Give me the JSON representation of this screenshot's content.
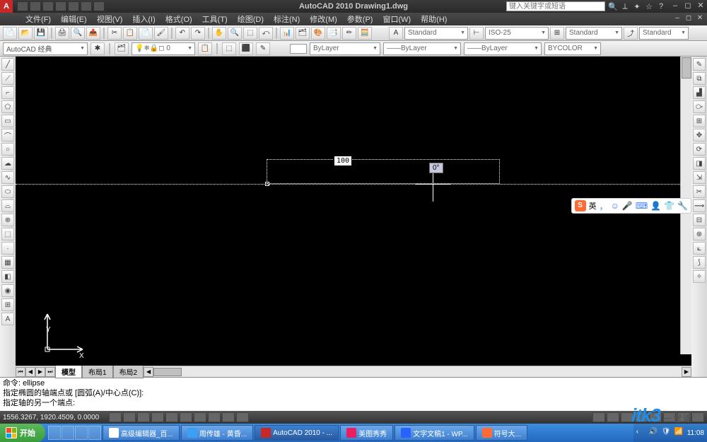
{
  "app": {
    "title": "AutoCAD 2010  Drawing1.dwg",
    "search_placeholder": "键入关键字或短语"
  },
  "menu": [
    "文件(F)",
    "编辑(E)",
    "视图(V)",
    "插入(I)",
    "格式(O)",
    "工具(T)",
    "绘图(D)",
    "标注(N)",
    "修改(M)",
    "参数(P)",
    "窗口(W)",
    "帮助(H)"
  ],
  "workspace": {
    "selector_label": "AutoCAD 经典"
  },
  "style_bar": {
    "text_style": "Standard",
    "dim_style": "ISO-25",
    "table_style": "Standard",
    "multi_style": "Standard"
  },
  "layer_bar": {
    "layer": "ByLayer",
    "linetype": "ByLayer",
    "lineweight": "ByLayer",
    "color_label": "BYCOLOR"
  },
  "canvas": {
    "dyn_value": "100",
    "dyn_angle": "0°",
    "ucs_x": "X",
    "ucs_y": "Y"
  },
  "tabs": {
    "model": "模型",
    "layout1": "布局1",
    "layout2": "布局2"
  },
  "command": {
    "line1": "命令:  ellipse",
    "line2": "指定椭圆的轴端点或 [圆弧(A)/中心点(C)]:",
    "line3": "指定轴的另一个端点:"
  },
  "status": {
    "coords": "1556.3267, 1920.4509, 0.0000"
  },
  "sogou": {
    "lang": "英",
    "comma": "，"
  },
  "taskbar": {
    "start": "开始",
    "items": [
      "高级编辑器_百...",
      "周传雄 - 黄昏...",
      "AutoCAD 2010 - ...",
      "美图秀秀",
      "文字文稿1 - WP...",
      "符号大..."
    ],
    "time": "11:08"
  },
  "watermark": {
    "brand": "itk3",
    "sub": "一堂课"
  }
}
